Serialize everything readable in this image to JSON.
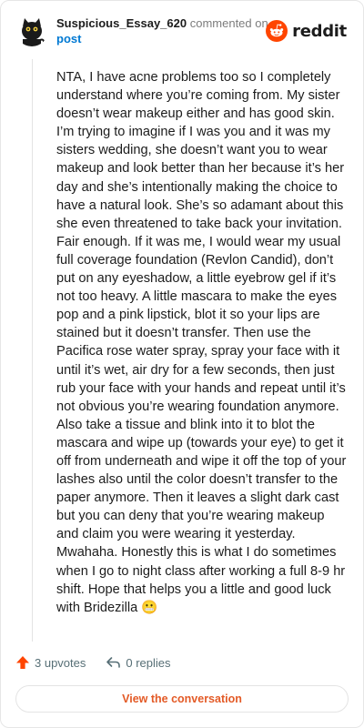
{
  "header": {
    "username": "Suspicious_Essay_620",
    "action_text": "commented on",
    "post_link": "post",
    "brand": "reddit"
  },
  "comment": {
    "body": "NTA, I have acne problems too so I completely understand where you’re coming from. My sister doesn’t wear makeup either and has good skin. I’m trying to imagine if I was you and it was my sisters wedding, she doesn’t want you to wear makeup and look better than her because it’s her day and she’s intentionally making the choice to have a natural look. She’s so adamant about this she even threatened to take back your invitation. Fair enough. If it was me, I would wear my usual full coverage foundation (Revlon Candid), don’t put on any eyeshadow, a little eyebrow gel if it’s not too heavy. A little mascara to make the eyes pop and a pink lipstick, blot it so your lips are stained but it doesn’t transfer. Then use the Pacifica rose water spray, spray your face with it until it’s wet, air dry for a few seconds, then just rub your face with your hands and repeat until it’s not obvious you’re wearing foundation anymore. Also take a tissue and blink into it to blot the mascara and wipe up (towards your eye) to get it off from underneath and wipe it off the top of your lashes also until the color doesn’t transfer to the paper anymore. Then it leaves a slight dark cast but you can deny that you’re wearing makeup and claim you were wearing it yesterday. Mwahaha. Honestly this is what I do sometimes when I go to night class after working a full 8-9 hr shift. Hope that helps you a little and good luck with Bridezilla 😬"
  },
  "actions": {
    "upvotes": "3 upvotes",
    "replies": "0 replies"
  },
  "footer": {
    "view_button": "View the conversation"
  },
  "colors": {
    "brand_orange": "#ff4500",
    "link_blue": "#0079d3",
    "button_text": "#e35a26",
    "muted": "#576f76"
  },
  "icons": {
    "avatar": "snoo-avatar-icon",
    "logo": "reddit-logo-icon",
    "upvote": "upvote-arrow-icon",
    "reply": "reply-arrow-icon"
  }
}
